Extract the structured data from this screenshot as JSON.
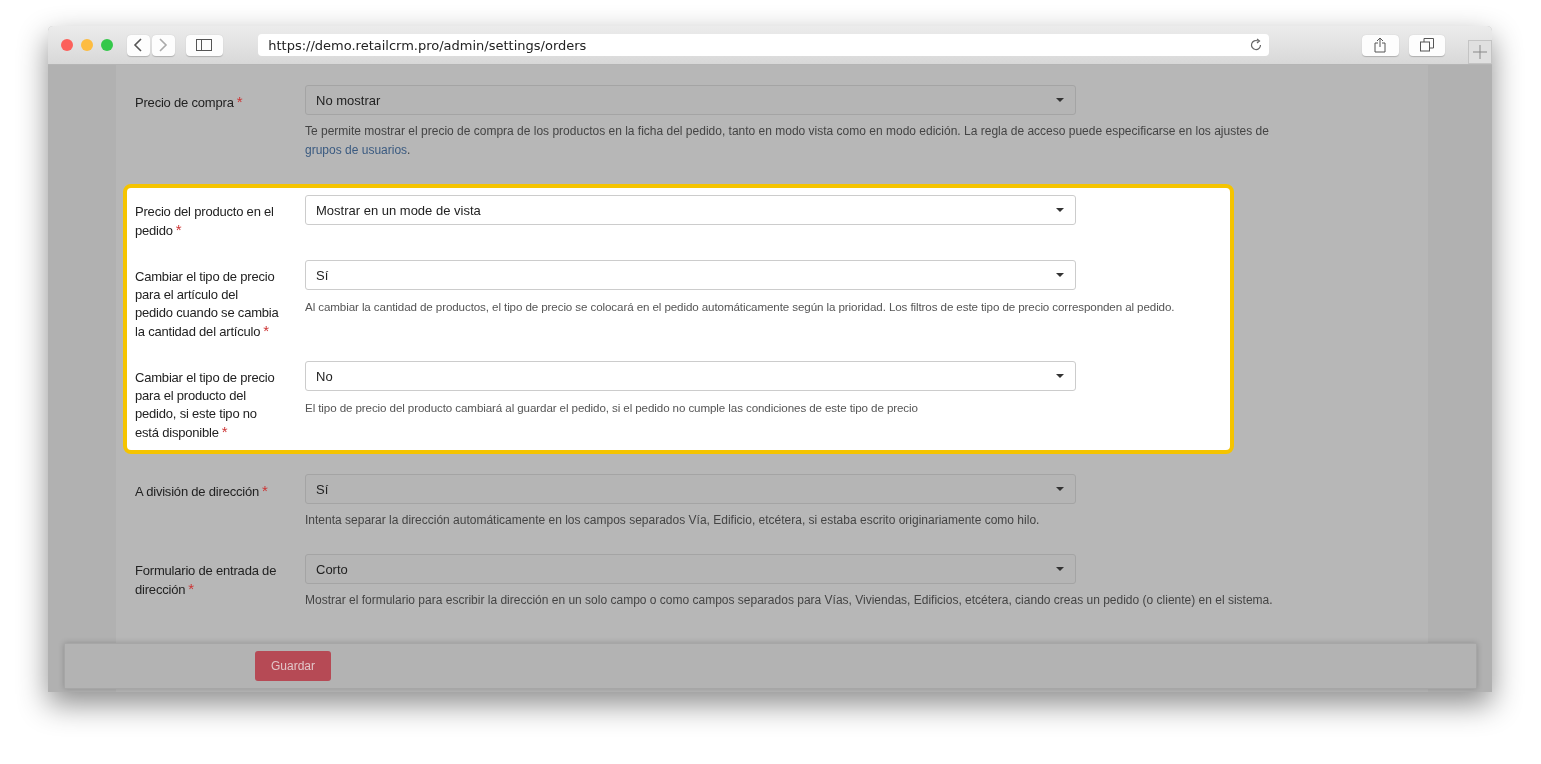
{
  "browser": {
    "url": "https://demo.retailcrm.pro/admin/settings/orders"
  },
  "sections": [
    {
      "highlighted": false,
      "rows": [
        {
          "label": "Precio de compra",
          "required_mark": "*",
          "value": "No mostrar",
          "help": "Te permite mostrar el precio de compra de los productos en la ficha del pedido, tanto en modo vista como en modo edición. La regla de acceso puede especificarse en los ajustes de",
          "help_link": "grupos de usuarios",
          "help_end": "."
        }
      ]
    },
    {
      "highlighted": true,
      "rows": [
        {
          "label": "Precio del producto en el pedido",
          "required_mark": "*",
          "value": "Mostrar en un mode de vista"
        },
        {
          "label": "Cambiar el tipo de precio para el artículo del pedido cuando se cambia la cantidad del artículo",
          "required_mark": "*",
          "value": "Sí",
          "help": "Al cambiar la cantidad de productos, el tipo de precio se colocará en el pedido automáticamente según la prioridad. Los filtros de este tipo de precio corresponden al pedido."
        },
        {
          "label": "Cambiar el tipo de precio para el producto del pedido, si este tipo no está disponible",
          "required_mark": "*",
          "value": "No",
          "help": "El tipo de precio del producto cambiará al guardar el pedido, si el pedido no cumple las condiciones de este tipo de precio"
        }
      ]
    },
    {
      "highlighted": false,
      "rows": [
        {
          "label": "A división de dirección",
          "required_mark": "*",
          "value": "Sí",
          "help": "Intenta separar la dirección automáticamente en los campos separados Vía, Edificio, etcétera, si estaba escrito originariamente como hilo."
        },
        {
          "label": "Formulario de entrada de dirección",
          "required_mark": "*",
          "value": "Corto",
          "help": "Mostrar el formulario para escribir la dirección en un solo campo o como campos separados para Vías, Viviendas, Edificios, etcétera, ciando creas un pedido (o cliente) en el sistema."
        }
      ]
    }
  ],
  "footer": {
    "save_button": "Guardar"
  }
}
